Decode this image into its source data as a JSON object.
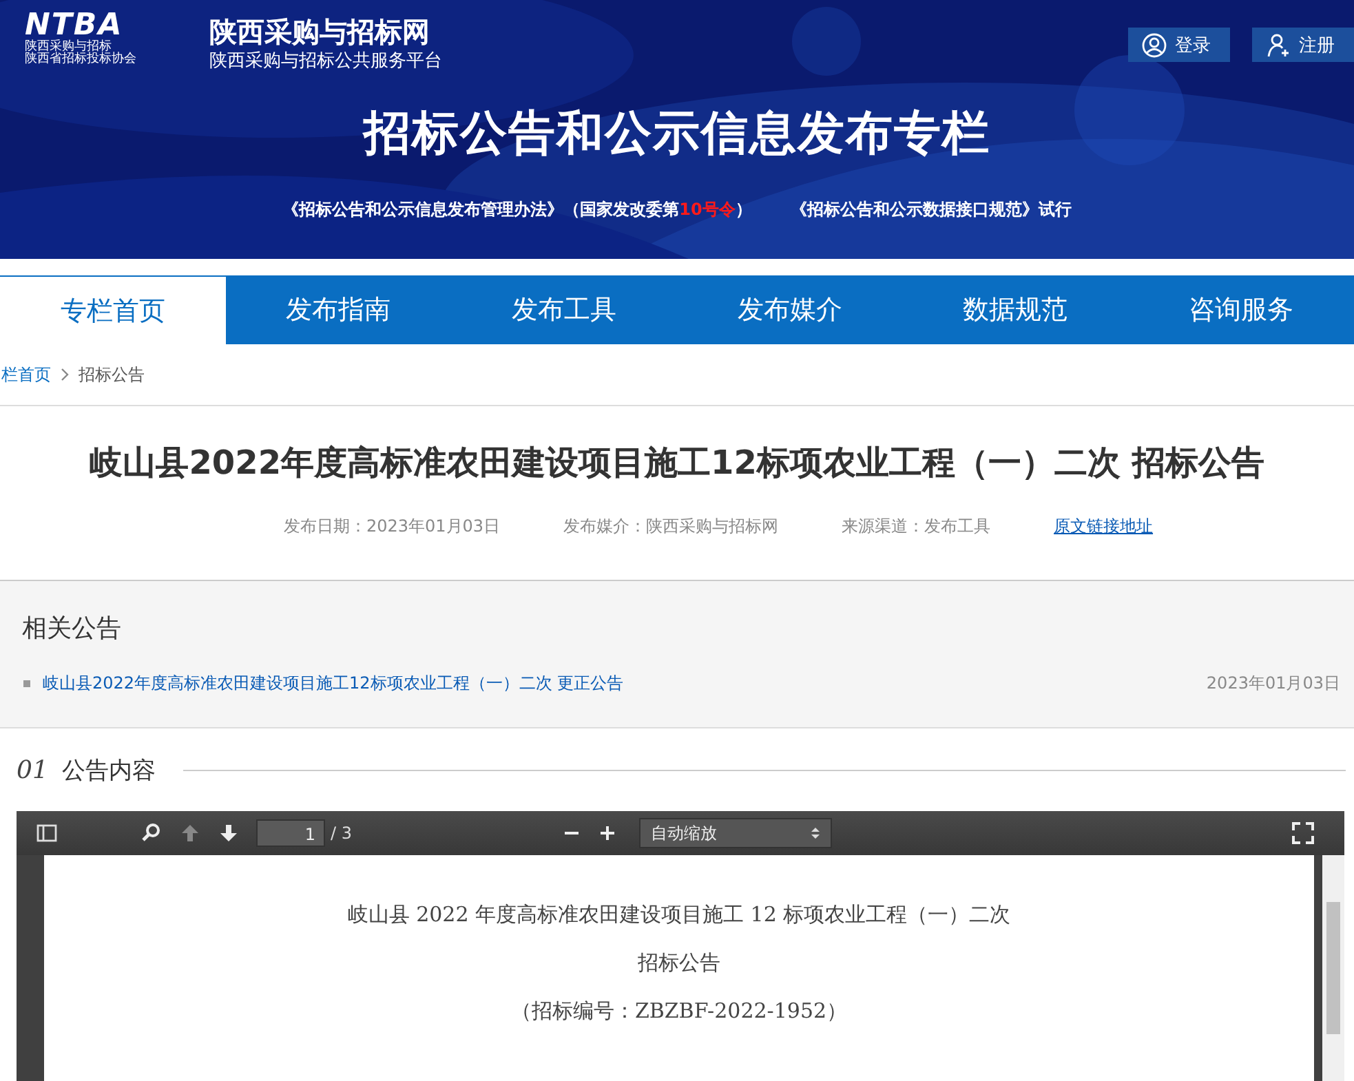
{
  "header": {
    "logo": {
      "mark": "NTBA",
      "line_1": "陕西采购与招标",
      "line_2": "陕西省招标投标协会"
    },
    "site_name": "陕西采购与招标网",
    "site_subtitle": "陕西采购与招标公共服务平台",
    "account_buttons": [
      {
        "kind": "login",
        "label": "登录"
      },
      {
        "kind": "register",
        "label": "注册"
      }
    ],
    "banner_title": "招标公告和公示信息发布专栏",
    "notices": [
      [
        {
          "text": "《招标公告和公示信息发布管理办法》（国家发改委第",
          "highlight": false
        },
        {
          "text": "10号令",
          "highlight": true
        },
        {
          "text": "）",
          "highlight": false
        }
      ],
      [
        {
          "text": "《招标公告和公示数据接口规范》试行",
          "highlight": false
        }
      ]
    ]
  },
  "nav": [
    {
      "label": "专栏首页",
      "selected": true
    },
    {
      "label": "发布指南",
      "selected": false
    },
    {
      "label": "发布工具",
      "selected": false
    },
    {
      "label": "发布媒介",
      "selected": false
    },
    {
      "label": "数据规范",
      "selected": false
    },
    {
      "label": "咨询服务",
      "selected": false
    }
  ],
  "breadcrumb": [
    "栏首页",
    "招标公告"
  ],
  "article": {
    "title": "岐山县2022年度高标准农田建设项目施工12标项农业工程（一）二次 招标公告",
    "meta": [
      "发布日期：2023年01月03日",
      "发布媒介：陕西采购与招标网",
      "来源渠道：发布工具"
    ],
    "source_link": "原文链接地址"
  },
  "related": {
    "heading": "相关公告",
    "items": [
      {
        "title": "岐山县2022年度高标准农田建设项目施工12标项农业工程（一）二次  更正公告",
        "date": "2023年01月03日"
      }
    ]
  },
  "section": {
    "number": "01",
    "title": "公告内容"
  },
  "pdf_viewer": {
    "page": "1",
    "page_count": "/ 3",
    "zoom": "自动缩放",
    "document_lines": [
      "岐山县 2022 年度高标准农田建设项目施工 12 标项农业工程（一）二次",
      "招标公告",
      "（招标编号：ZBZBF-2022-1952）"
    ]
  }
}
